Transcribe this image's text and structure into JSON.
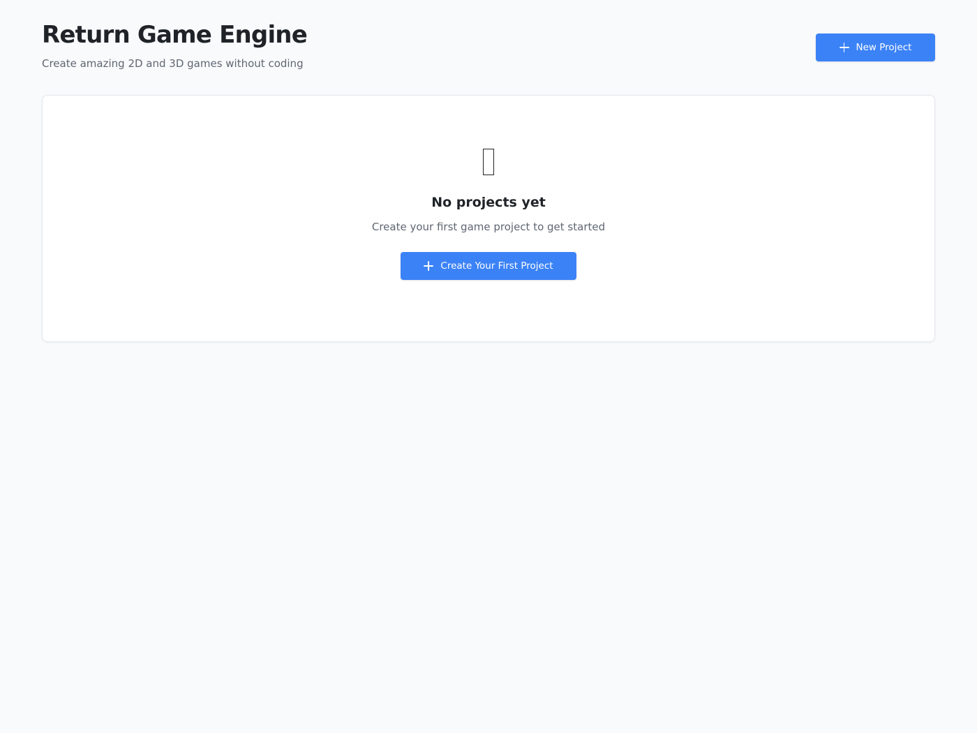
{
  "header": {
    "title": "Return Game Engine",
    "subtitle": "Create amazing 2D and 3D games without coding",
    "new_project_label": "New Project"
  },
  "empty_state": {
    "icon": "placeholder-icon",
    "title": "No projects yet",
    "text": "Create your first game project to get started",
    "button_label": "Create Your First Project"
  },
  "colors": {
    "accent": "#3b82f6",
    "background": "#f9fafb",
    "card": "#ffffff"
  }
}
